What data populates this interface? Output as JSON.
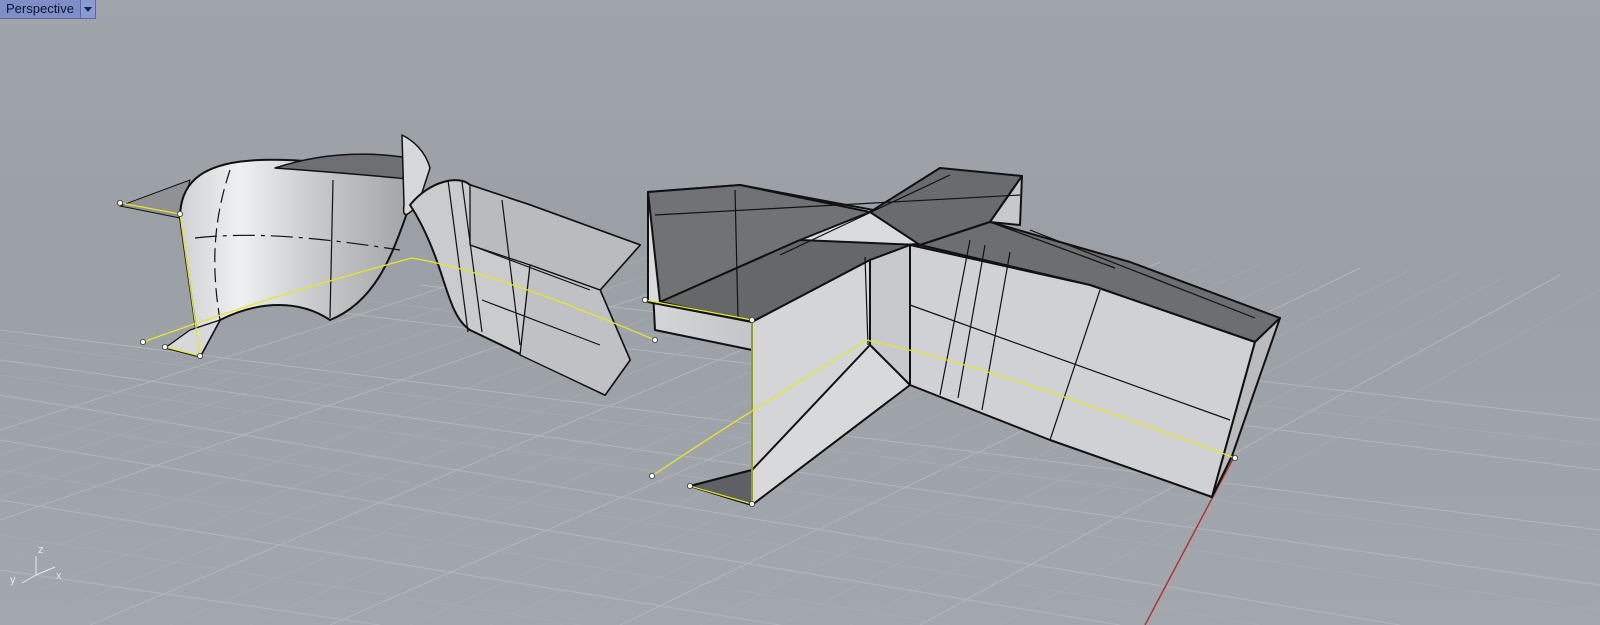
{
  "viewport": {
    "title": "Perspective",
    "menu_icon": "chevron-down-icon"
  },
  "axes_widget": {
    "x": "x",
    "y": "y",
    "z": "z"
  },
  "colors": {
    "background": "#9ea3a9",
    "grid": "#b3b8be",
    "selection_curve": "#e6e62a",
    "x_axis": "#b0302a",
    "surface_light": "#d6d8da",
    "surface_dark": "#6e7074"
  }
}
